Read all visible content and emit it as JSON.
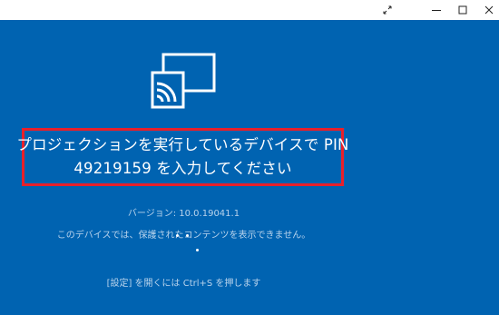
{
  "window": {
    "buttons": {
      "fullscreen": "fullscreen-toggle",
      "minimize": "minimize",
      "maximize": "maximize",
      "close": "close"
    }
  },
  "main": {
    "icon": "projection-icon",
    "pin_prompt_line1": "プロジェクションを実行しているデバイスで PIN",
    "pin_prompt_line2": "49219159 を入力してください",
    "version": "バージョン: 10.0.19041.1",
    "protection_notice": "このデバイスでは、保護されたコンテンツを表示できません。",
    "settings_hint": "[設定] を開くには Ctrl+S を押します"
  },
  "colors": {
    "background": "#0063b1",
    "highlight_border": "#e8202a",
    "text": "#ffffff",
    "muted_text": "#b8d3ec"
  }
}
